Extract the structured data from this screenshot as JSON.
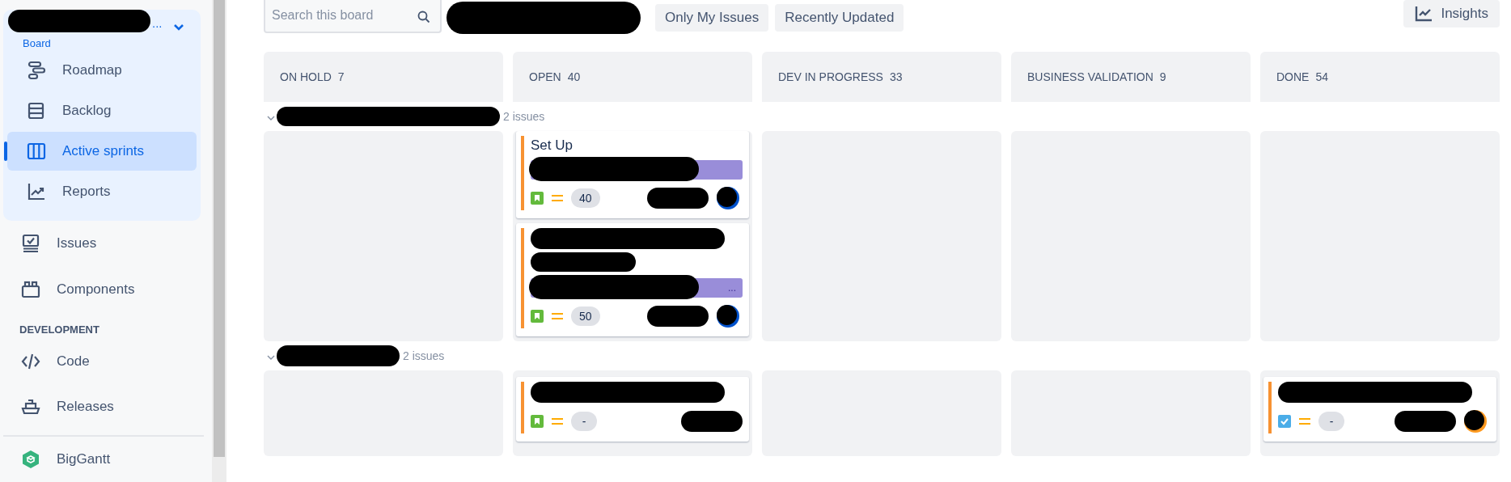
{
  "sidebar": {
    "project_name": "...",
    "board_label": "Board",
    "group_items": [
      {
        "label": "Roadmap",
        "selected": false
      },
      {
        "label": "Backlog",
        "selected": false
      },
      {
        "label": "Active sprints",
        "selected": true
      },
      {
        "label": "Reports",
        "selected": false
      }
    ],
    "items": [
      {
        "label": "Issues",
        "selected": false
      },
      {
        "label": "Components",
        "selected": false
      }
    ],
    "section_heading": "DEVELOPMENT",
    "dev_items": [
      {
        "label": "Code",
        "selected": false
      },
      {
        "label": "Releases",
        "selected": false
      }
    ],
    "apps": [
      {
        "label": "BigGantt",
        "selected": false
      }
    ]
  },
  "toolbar": {
    "search": {
      "placeholder": "Search this board"
    },
    "filters": [
      "Only My Issues",
      "Recently Updated"
    ],
    "insights": "Insights"
  },
  "columns": [
    {
      "name": "ON HOLD",
      "count": "7"
    },
    {
      "name": "OPEN",
      "count": "40"
    },
    {
      "name": "DEV IN PROGRESS",
      "count": "33"
    },
    {
      "name": "BUSINESS VALIDATION",
      "count": "9"
    },
    {
      "name": "DONE",
      "count": "54"
    }
  ],
  "swimlanes": [
    {
      "issue_count": "2 issues",
      "expanded": true,
      "cells": [
        [],
        [
          {
            "title": "Set Up",
            "epic": true,
            "kind": "story",
            "points": "40",
            "color": "#0052cc"
          },
          {
            "epic": true,
            "epic_label": "...",
            "kind": "story",
            "points": "50",
            "color": "#0052cc"
          }
        ],
        [],
        [],
        []
      ]
    },
    {
      "issue_count": "2 issues",
      "expanded": true,
      "cells": [
        [],
        [
          {
            "epic": false,
            "kind": "story",
            "points": "-"
          }
        ],
        [],
        [],
        [
          {
            "epic": false,
            "kind": "task",
            "points": "-",
            "color": "#ff991f"
          }
        ]
      ]
    }
  ]
}
